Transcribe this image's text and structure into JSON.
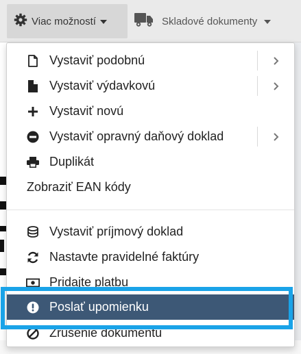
{
  "toolbar": {
    "more_label": "Viac možností",
    "stock_label": "Skladové dokumenty"
  },
  "menu": {
    "items": [
      {
        "label": "Vystaviť podobnú",
        "icon": "file-outline-icon",
        "submenu": true
      },
      {
        "label": "Vystaviť výdavkovú",
        "icon": "file-solid-icon",
        "submenu": true
      },
      {
        "label": "Vystaviť novú",
        "icon": "plus-icon",
        "submenu": false
      },
      {
        "label": "Vystaviť opravný daňový doklad",
        "icon": "minus-circle-icon",
        "submenu": true
      },
      {
        "label": "Duplikát",
        "icon": "print-icon",
        "submenu": false
      },
      {
        "label": "Zobraziť EAN kódy",
        "icon": "",
        "submenu": false
      },
      {
        "label": "Vystaviť príjmový doklad",
        "icon": "coins-icon",
        "submenu": false
      },
      {
        "label": "Nastavte pravidelné faktúry",
        "icon": "refresh-icon",
        "submenu": false
      },
      {
        "label": "Pridajte platbu",
        "icon": "money-bill-icon",
        "submenu": false
      },
      {
        "label": "Poslať upomienku",
        "icon": "exclamation-circle-icon",
        "submenu": false,
        "active": true
      },
      {
        "label": "Zrušenie dokumentu",
        "icon": "ban-icon",
        "submenu": false
      }
    ]
  },
  "colors": {
    "active_bg": "#3d5876",
    "highlight_border": "#1aa3e8"
  }
}
